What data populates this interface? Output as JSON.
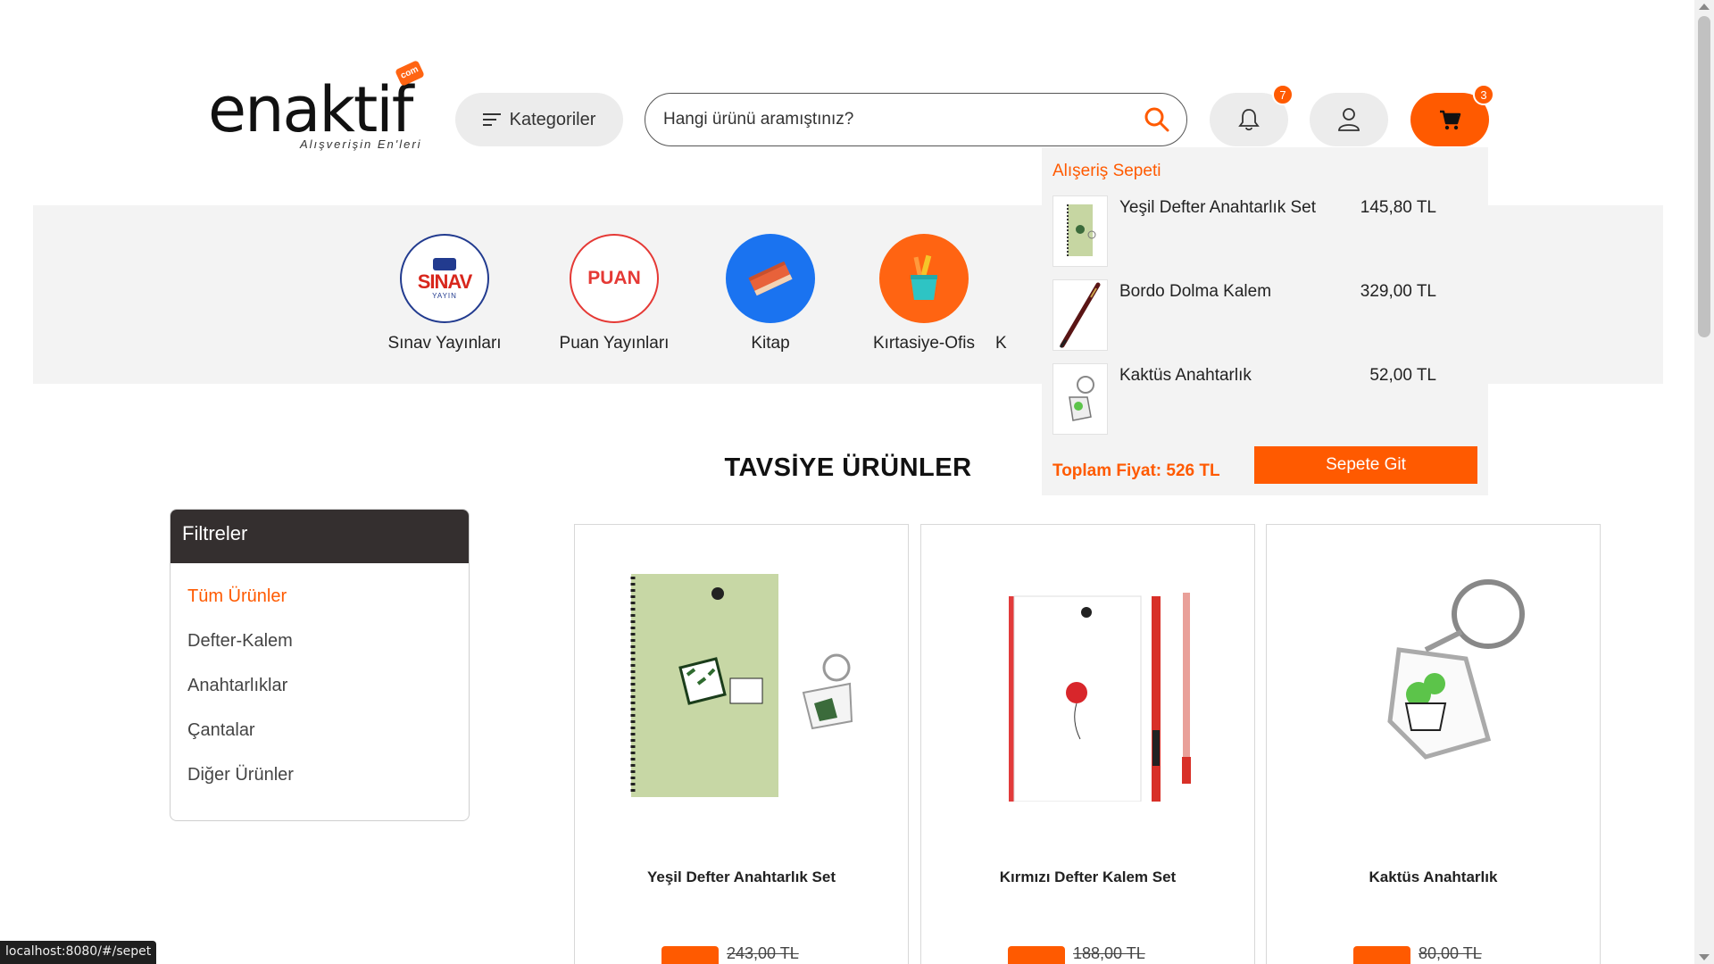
{
  "header": {
    "logo_text": "enaktif",
    "logo_tagline": "Alışverişin En'leri",
    "logo_badge": "com",
    "categories_label": "Kategoriler",
    "search_placeholder": "Hangi ürünü aramıştınız?",
    "notifications_count": "7",
    "cart_count": "3",
    "icons": [
      "menu-icon",
      "search-icon",
      "bell-icon",
      "user-icon",
      "cart-icon"
    ],
    "accent_color": "#ff5a00"
  },
  "category_strip": {
    "items": [
      {
        "label": "Sınav Yayınları",
        "logo": "SINAV",
        "logo_sub": "YAYIN"
      },
      {
        "label": "Puan Yayınları",
        "logo": "PUAN"
      },
      {
        "label": "Kitap",
        "icon": "book-icon"
      },
      {
        "label": "Kırtasiye-Ofis",
        "icon": "pencil-cup-icon"
      },
      {
        "label": "K"
      }
    ]
  },
  "cart_popup": {
    "title": "Alışeriş Sepeti",
    "items": [
      {
        "name": "Yeşil Defter Anahtarlık Set",
        "price": "145,80 TL"
      },
      {
        "name": "Bordo Dolma Kalem",
        "price": "329,00 TL"
      },
      {
        "name": "Kaktüs Anahtarlık",
        "price": "52,00 TL"
      }
    ],
    "total": "Toplam Fiyat: 526 TL",
    "go_button": "Sepete Git"
  },
  "section_title": "TAVSİYE ÜRÜNLER",
  "filters": {
    "title": "Filtreler",
    "items": [
      "Tüm Ürünler",
      "Defter-Kalem",
      "Anahtarlıklar",
      "Çantalar",
      "Diğer Ürünler"
    ],
    "active_index": 0
  },
  "products": [
    {
      "name": "Yeşil Defter Anahtarlık Set",
      "old_price": "243,00 TL"
    },
    {
      "name": "Kırmızı Defter Kalem Set",
      "old_price": "188,00 TL"
    },
    {
      "name": "Kaktüs Anahtarlık",
      "old_price": "80,00 TL"
    }
  ],
  "status_bar": {
    "url": "localhost:8080/#/sepet"
  }
}
